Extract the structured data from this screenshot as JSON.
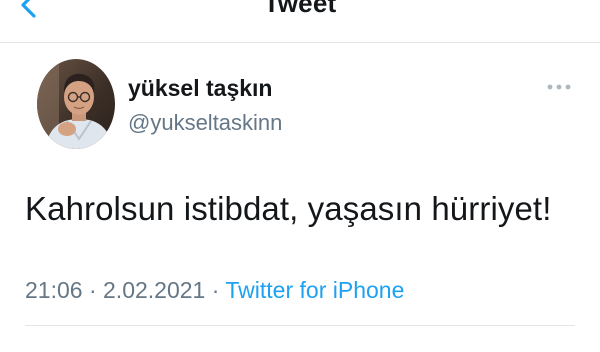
{
  "nav": {
    "title": "Tweet"
  },
  "tweet": {
    "display_name": "yüksel taşkın",
    "handle": "@yukseltaskinn",
    "text": "Kahrolsun istibdat, yaşasın hürriyet!",
    "time": "21:06",
    "separator": "·",
    "date": "2.02.2021",
    "source": "Twitter for iPhone"
  },
  "icons": {
    "back": "chevron-left-icon",
    "more": "more-horizontal-icon",
    "avatar": "profile-photo"
  },
  "colors": {
    "accent": "#1da1f2",
    "text": "#14171a",
    "secondary": "#657786",
    "divider": "#e1e5e9"
  }
}
